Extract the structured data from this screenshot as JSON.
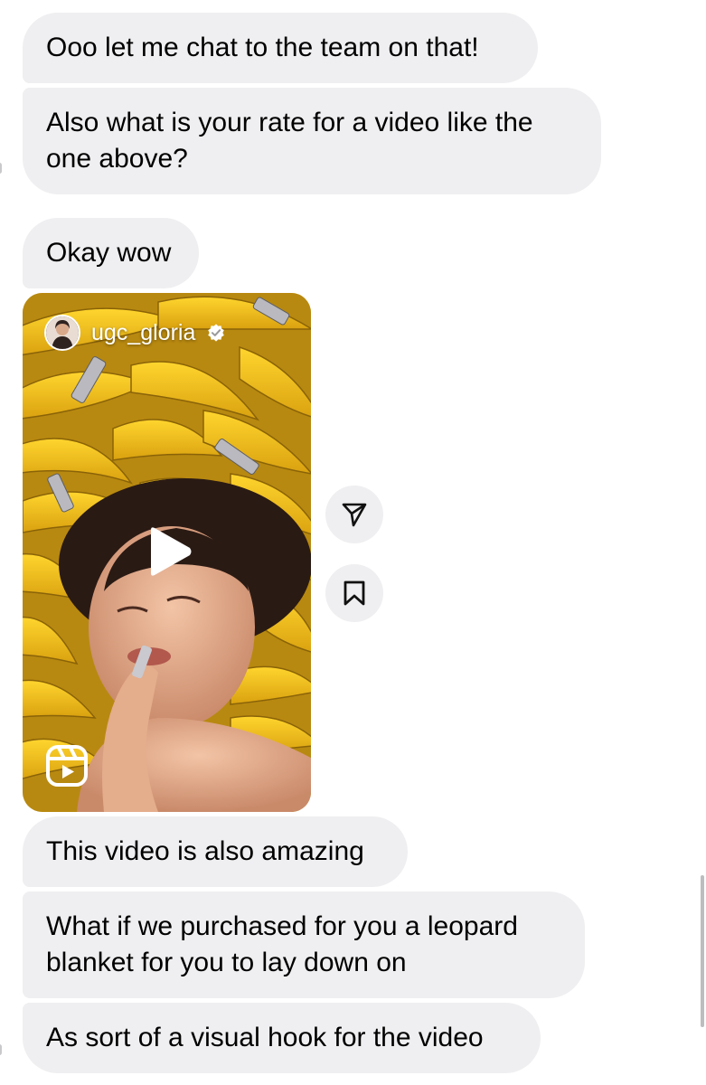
{
  "messages": [
    {
      "text": "Ooo let me chat to the team on that!"
    },
    {
      "lines": [
        "Also what is your rate for a video like the",
        "one above?"
      ]
    },
    {
      "text": "Okay wow"
    },
    {
      "text": "This video is also amazing"
    },
    {
      "lines": [
        "What if we purchased for you a leopard",
        "blanket for you to lay down on"
      ]
    },
    {
      "text": "As sort of a visual hook for the video"
    }
  ],
  "reel": {
    "username": "ugc_gloria",
    "verified": true,
    "icons": [
      "avatar",
      "verified-icon",
      "play-icon",
      "reels-icon"
    ]
  },
  "actions": {
    "share_icon": "paper-plane-icon",
    "save_icon": "bookmark-icon"
  },
  "colors": {
    "bubble": "#efeff1",
    "text": "#000000",
    "banana": "#f2c21b"
  }
}
